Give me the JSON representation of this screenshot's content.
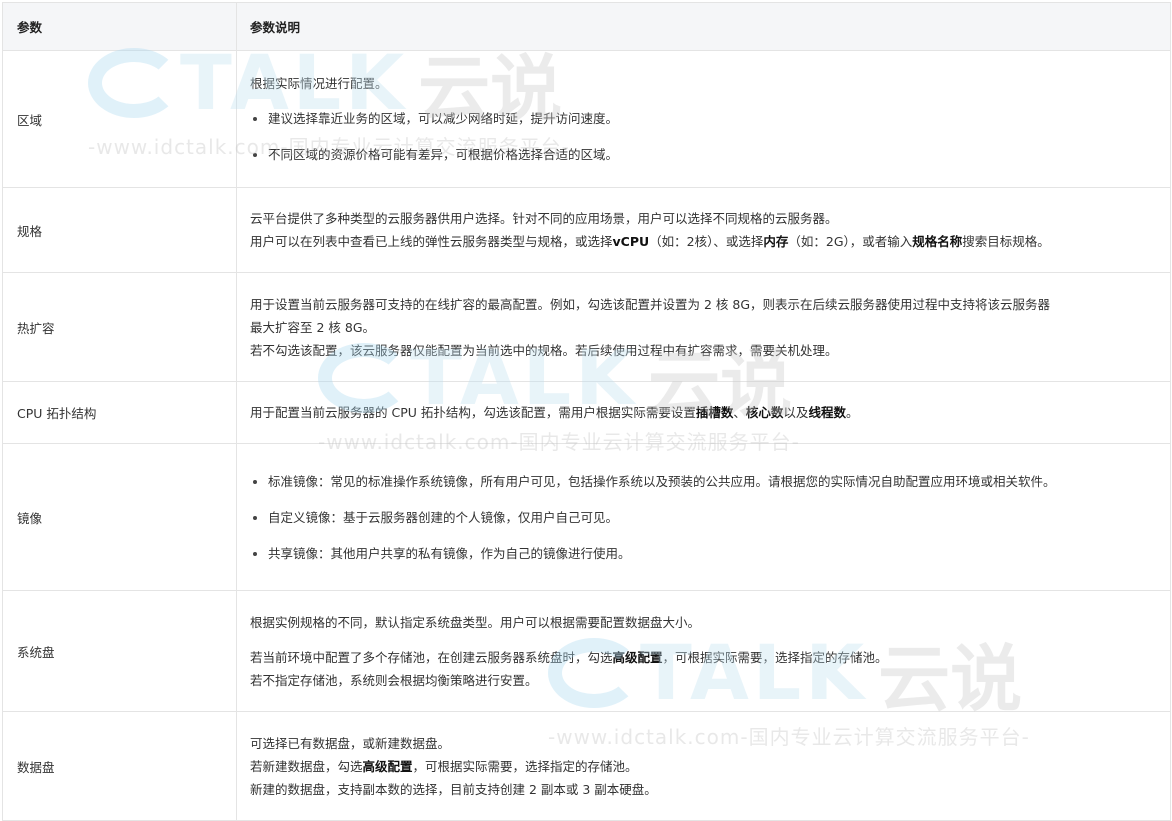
{
  "header": {
    "col1": "参数",
    "col2": "参数说明"
  },
  "watermark": {
    "brand": "TALK",
    "brand_cn": "云说",
    "url": "-www.idctalk.com-国内专业云计算交流服务平台-"
  },
  "rows": [
    {
      "param": "区域",
      "intro": "根据实际情况进行配置。",
      "bullets": [
        "建议选择靠近业务的区域，可以减少网络时延，提升访问速度。",
        "不同区域的资源价格可能有差异，可根据价格选择合适的区域。"
      ]
    },
    {
      "param": "规格",
      "line1": "云平台提供了多种类型的云服务器供用户选择。针对不同的应用场景，用户可以选择不同规格的云服务器。",
      "line2": [
        "用户可以在列表中查看已上线的弹性云服务器类型与规格，或选择",
        "vCPU",
        "（如：2核）、或选择",
        "内存",
        "（如：2G），或者输入",
        "规格名称",
        "搜索目标规格。"
      ]
    },
    {
      "param": "热扩容",
      "line1": "用于设置当前云服务器可支持的在线扩容的最高配置。例如，勾选该配置并设置为 2 核 8G，则表示在后续云服务器使用过程中支持将该云服务器",
      "line2": "最大扩容至 2 核 8G。",
      "line3": "若不勾选该配置，该云服务器仅能配置为当前选中的规格。若后续使用过程中有扩容需求，需要关机处理。"
    },
    {
      "param": "CPU 拓扑结构",
      "line1": [
        "用于配置当前云服务器的 CPU 拓扑结构，勾选该配置，需用户根据实际需要设置",
        "插槽数",
        "、",
        "核心数",
        "以及",
        "线程数",
        "。"
      ]
    },
    {
      "param": "镜像",
      "bullets": [
        "标准镜像：常见的标准操作系统镜像，所有用户可见，包括操作系统以及预装的公共应用。请根据您的实际情况自助配置应用环境或相关软件。",
        "自定义镜像：基于云服务器创建的个人镜像，仅用户自己可见。",
        "共享镜像：其他用户共享的私有镜像，作为自己的镜像进行使用。"
      ]
    },
    {
      "param": "系统盘",
      "line1": "根据实例规格的不同，默认指定系统盘类型。用户可以根据需要配置数据盘大小。",
      "line2": [
        "若当前环境中配置了多个存储池，在创建云服务器系统盘时，勾选",
        "高级配置",
        "，可根据实际需要，选择指定的存储池。"
      ],
      "line3": "若不指定存储池，系统则会根据均衡策略进行安置。"
    },
    {
      "param": "数据盘",
      "line1": "可选择已有数据盘，或新建数据盘。",
      "line2": [
        "若新建数据盘，勾选",
        "高级配置",
        "，可根据实际需要，选择指定的存储池。"
      ],
      "line3": "新建的数据盘，支持副本数的选择，目前支持创建 2 副本或 3 副本硬盘。"
    }
  ]
}
